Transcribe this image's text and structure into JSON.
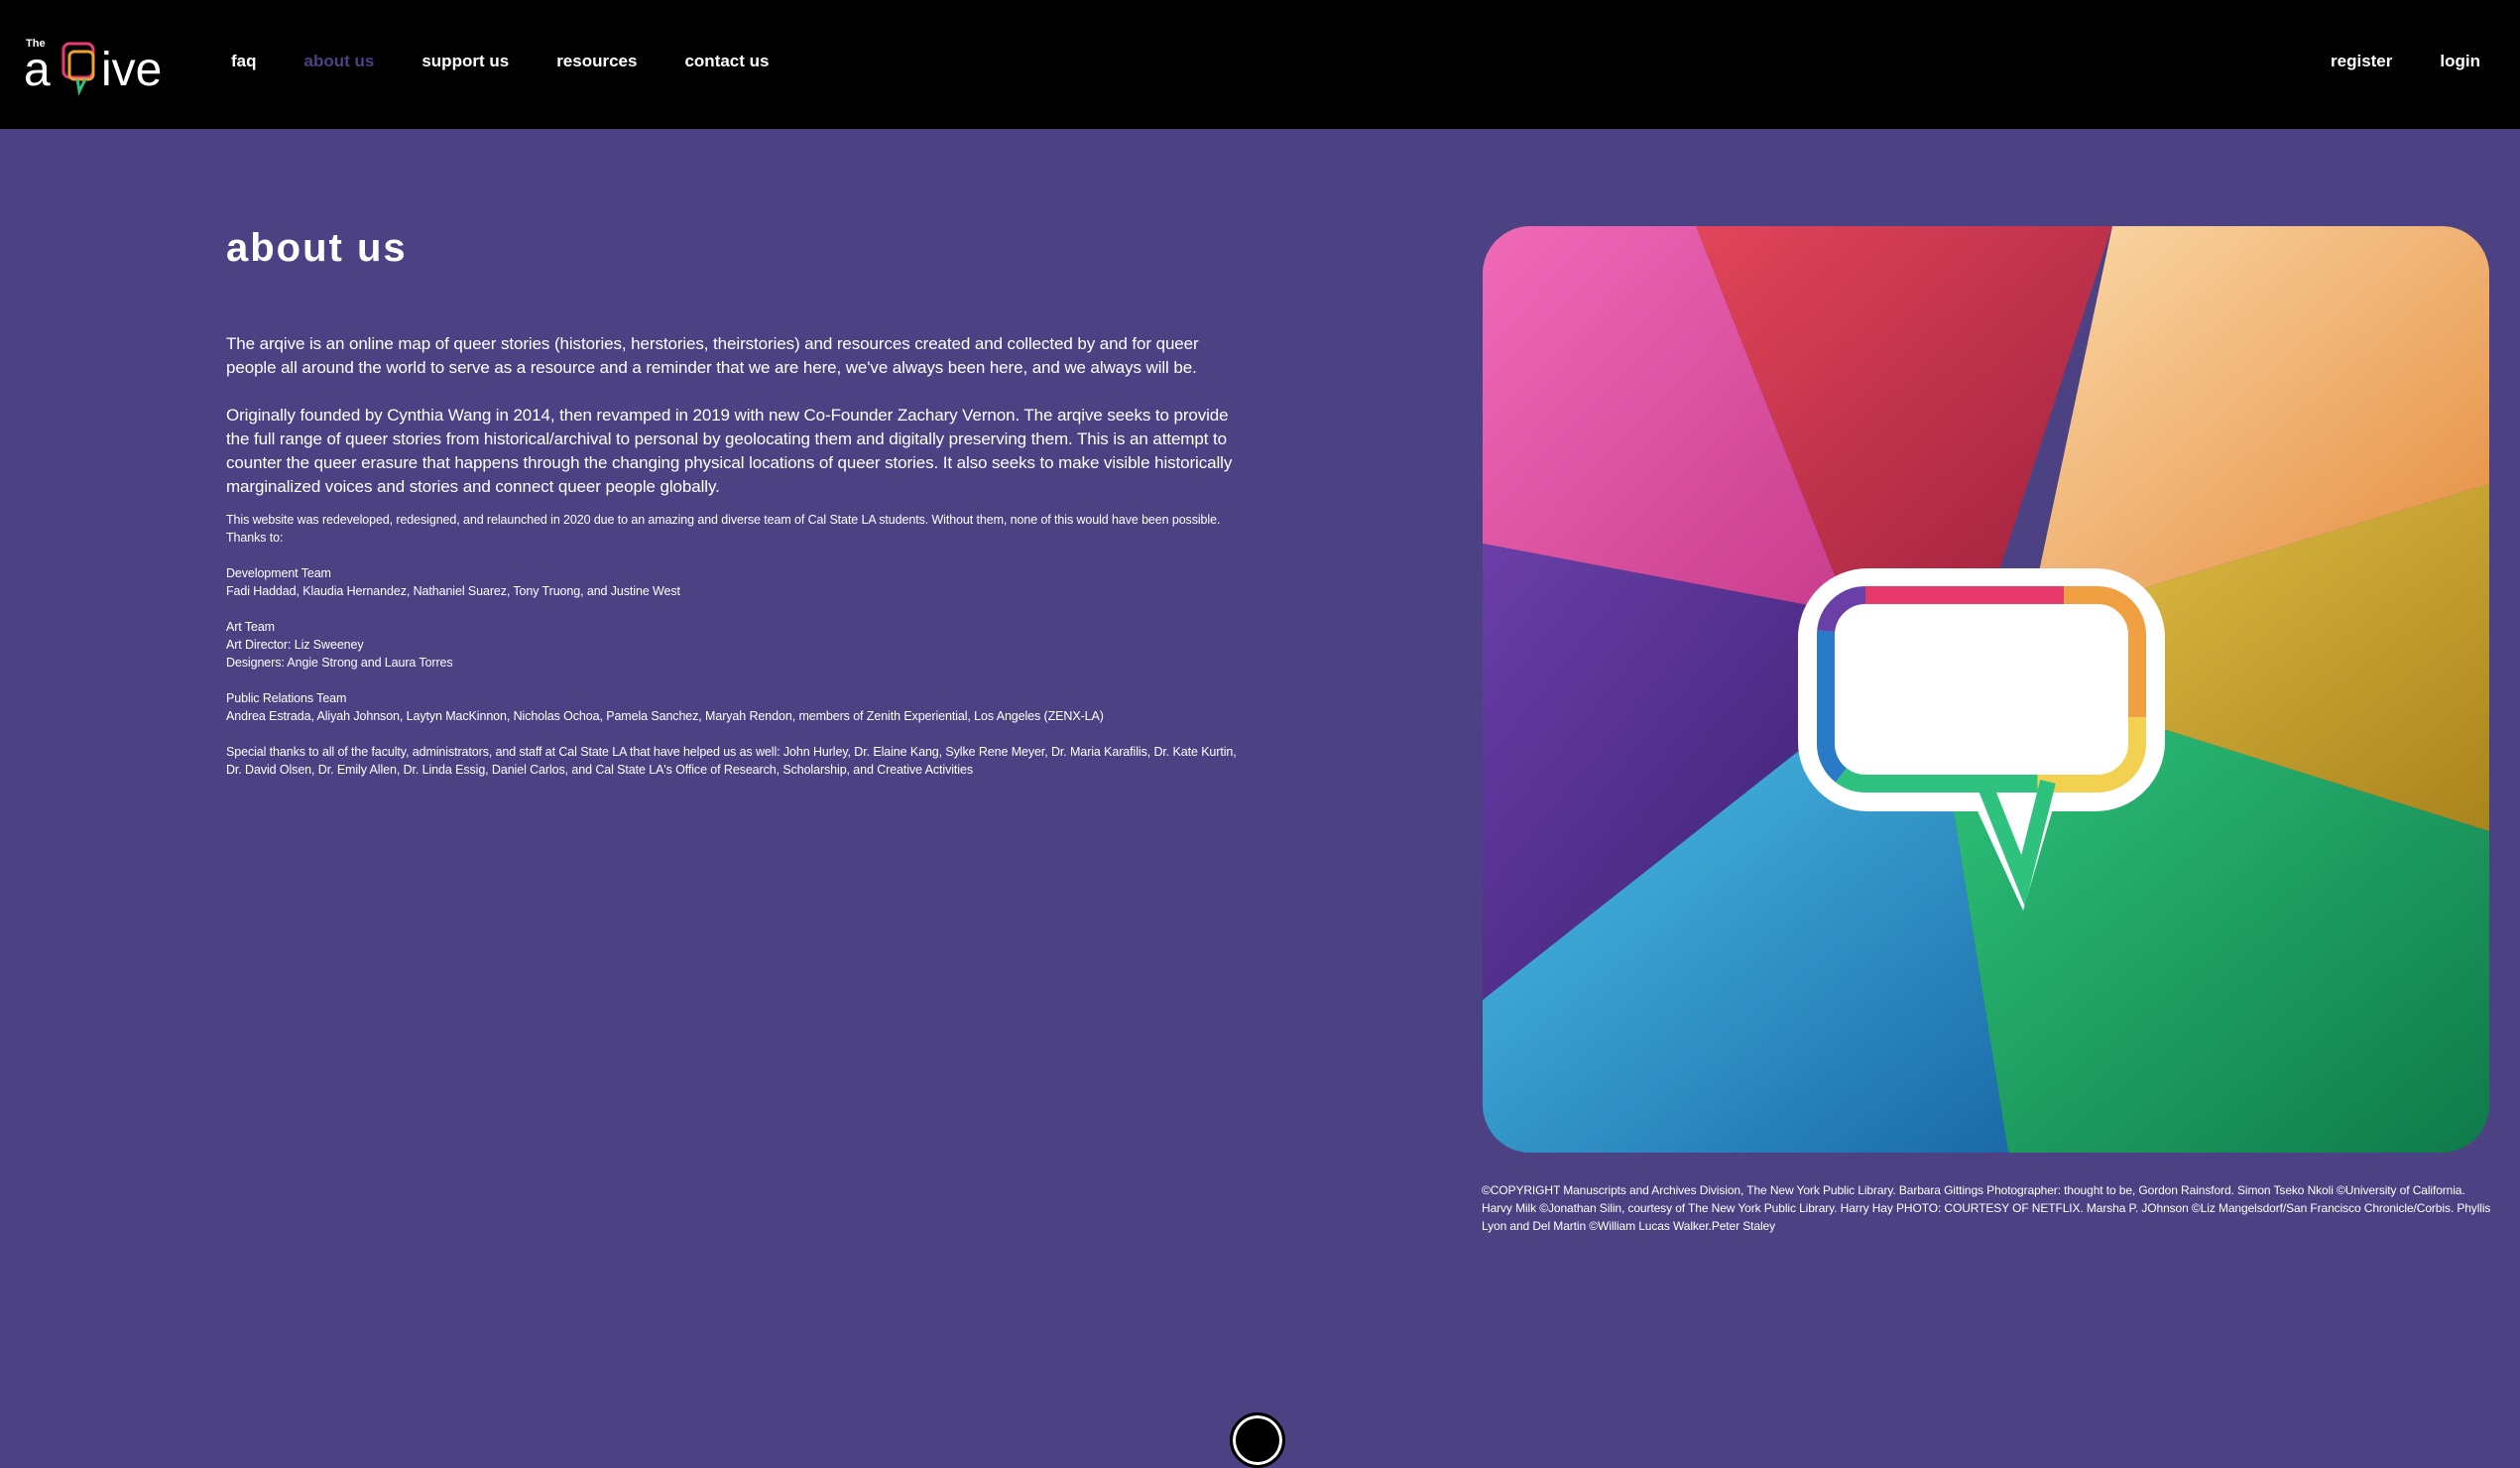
{
  "nav": {
    "logo_small": "The",
    "logo_text": "arqive",
    "links": [
      "faq",
      "about us",
      "support us",
      "resources",
      "contact us"
    ],
    "active": "about us",
    "right": [
      "register",
      "login"
    ]
  },
  "page": {
    "title": "about us",
    "paragraphs": [
      "The arqive is an online map of queer stories (histories, herstories, theirstories) and resources created and collected by and for queer people all around the world to serve as a resource and a reminder that we are here, we've always been here, and we always will be.",
      "Originally founded by Cynthia Wang in 2014, then revamped in 2019 with new Co-Founder Zachary Vernon. The arqive seeks to provide the full range of queer stories from historical/archival to personal by geolocating them and digitally preserving them. This is an attempt to counter the queer erasure that happens through the changing physical locations of queer stories. It also seeks to make visible historically marginalized voices and stories and connect queer people globally."
    ],
    "intro_small": "This website was redeveloped, redesigned, and relaunched in 2020 due to an amazing and diverse team of Cal State LA students. Without them, none of this would have been possible. Thanks to:",
    "dev_team_title": "Development Team",
    "dev_team": "Fadi Haddad, Klaudia Hernandez, Nathaniel Suarez, Tony Truong, and Justine West",
    "art_team_title": "Art Team",
    "art_director": "Art Director: Liz Sweeney",
    "designers": "Designers: Angie Strong and Laura Torres",
    "pr_team_title": "Public Relations Team",
    "pr_team": "Andrea Estrada, Aliyah Johnson, Laytyn MacKinnon, Nicholas Ochoa, Pamela Sanchez, Maryah Rendon, members of Zenith Experiential, Los Angeles (ZENX-LA)",
    "special_thanks": "Special thanks to all of the faculty, administrators, and staff at Cal State LA that have helped us as well: John Hurley, Dr. Elaine Kang, Sylke Rene Meyer, Dr. Maria Karafilis, Dr. Kate Kurtin, Dr. David Olsen, Dr. Emily Allen, Dr. Linda Essig, Daniel Carlos, and Cal State LA's Office of Research, Scholarship, and Creative Activities"
  },
  "caption": "©COPYRIGHT Manuscripts and Archives Division, The New York Public Library. Barbara Gittings Photographer: thought to be, Gordon Rainsford. Simon Tseko Nkoli ©University of California. Harvy Milk ©Jonathan Silin, courtesy of The New York Public Library. Harry Hay PHOTO: COURTESY OF NETFLIX. Marsha P. JOhnson ©Liz Mangelsdorf/San Francisco Chronicle/Corbis. Phyllis Lyon and Del Martin ©William Lucas Walker.Peter Staley",
  "colors": {
    "background": "#4c4183",
    "nav": "#000000",
    "active_link": "#4c4183"
  }
}
